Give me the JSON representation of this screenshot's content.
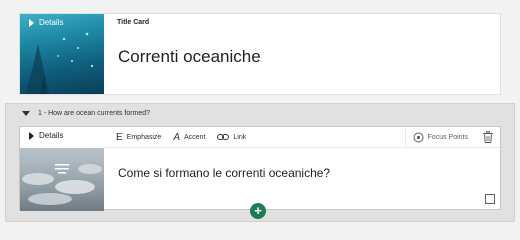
{
  "title_card": {
    "details_label": "Details",
    "card_type": "Title Card",
    "title": "Correnti oceaniche"
  },
  "question_group": {
    "header": "1 - How are ocean currents formed?",
    "details_label": "Details",
    "toolbar": {
      "emphasize_icon": "E",
      "emphasize": "Emphasize",
      "accent_icon": "A",
      "accent": "Accent",
      "link": "Link",
      "focus_points": "Focus Points"
    },
    "question_text": "Come si formano le correnti oceaniche?"
  },
  "add_button": "+",
  "colors": {
    "accent_green": "#1f7a56",
    "ocean_dark": "#0a3e56"
  },
  "icons": [
    "chevron-right-icon",
    "chevron-down-icon",
    "text-icon",
    "link-icon",
    "focus-points-icon",
    "trash-icon",
    "plus-icon"
  ]
}
